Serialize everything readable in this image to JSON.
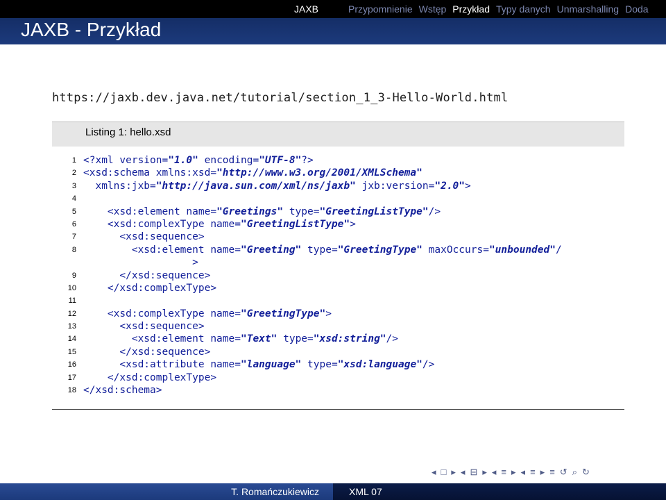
{
  "header": {
    "section": "JAXB",
    "subsections": [
      "Przypomnienie",
      "Wstęp",
      "Przykład",
      "Typy danych",
      "Unmarshalling",
      "Doda"
    ],
    "active_subsection": 2,
    "title": "JAXB - Przykład"
  },
  "url": "https://jaxb.dev.java.net/tutorial/section_1_3-Hello-World.html",
  "listing": {
    "caption": "Listing 1: hello.xsd",
    "lines": [
      {
        "n": "1",
        "segs": [
          [
            "t",
            "<?xml version="
          ],
          [
            "s",
            "\"1.0\""
          ],
          [
            "t",
            " encoding="
          ],
          [
            "s",
            "\"UTF-8\""
          ],
          [
            "t",
            "?>"
          ]
        ]
      },
      {
        "n": "2",
        "segs": [
          [
            "t",
            "<xsd:schema xmlns:xsd="
          ],
          [
            "s",
            "\"http://www.w3.org/2001/XMLSchema\""
          ]
        ]
      },
      {
        "n": "3",
        "segs": [
          [
            "t",
            "  xmlns:jxb="
          ],
          [
            "s",
            "\"http://java.sun.com/xml/ns/jaxb\""
          ],
          [
            "t",
            " jxb:version="
          ],
          [
            "s",
            "\"2.0\""
          ],
          [
            "t",
            ">"
          ]
        ]
      },
      {
        "n": "4",
        "segs": []
      },
      {
        "n": "5",
        "segs": [
          [
            "t",
            "    <xsd:element name="
          ],
          [
            "s",
            "\"Greetings\""
          ],
          [
            "t",
            " type="
          ],
          [
            "s",
            "\"GreetingListType\""
          ],
          [
            "t",
            "/>"
          ]
        ]
      },
      {
        "n": "6",
        "segs": [
          [
            "t",
            "    <xsd:complexType name="
          ],
          [
            "s",
            "\"GreetingListType\""
          ],
          [
            "t",
            ">"
          ]
        ]
      },
      {
        "n": "7",
        "segs": [
          [
            "t",
            "      <xsd:sequence>"
          ]
        ]
      },
      {
        "n": "8",
        "segs": [
          [
            "t",
            "        <xsd:element name="
          ],
          [
            "s",
            "\"Greeting\""
          ],
          [
            "t",
            " type="
          ],
          [
            "s",
            "\"GreetingType\""
          ],
          [
            "t",
            " maxOccurs="
          ],
          [
            "s",
            "\"unbounded\""
          ],
          [
            "t",
            "/"
          ]
        ]
      },
      {
        "n": "",
        "segs": [
          [
            "t",
            "                  >"
          ]
        ]
      },
      {
        "n": "9",
        "segs": [
          [
            "t",
            "      </xsd:sequence>"
          ]
        ]
      },
      {
        "n": "10",
        "segs": [
          [
            "t",
            "    </xsd:complexType>"
          ]
        ]
      },
      {
        "n": "11",
        "segs": []
      },
      {
        "n": "12",
        "segs": [
          [
            "t",
            "    <xsd:complexType name="
          ],
          [
            "s",
            "\"GreetingType\""
          ],
          [
            "t",
            ">"
          ]
        ]
      },
      {
        "n": "13",
        "segs": [
          [
            "t",
            "      <xsd:sequence>"
          ]
        ]
      },
      {
        "n": "14",
        "segs": [
          [
            "t",
            "        <xsd:element name="
          ],
          [
            "s",
            "\"Text\""
          ],
          [
            "t",
            " type="
          ],
          [
            "s",
            "\"xsd:string\""
          ],
          [
            "t",
            "/>"
          ]
        ]
      },
      {
        "n": "15",
        "segs": [
          [
            "t",
            "      </xsd:sequence>"
          ]
        ]
      },
      {
        "n": "16",
        "segs": [
          [
            "t",
            "      <xsd:attribute name="
          ],
          [
            "s",
            "\"language\""
          ],
          [
            "t",
            " type="
          ],
          [
            "s",
            "\"xsd:language\""
          ],
          [
            "t",
            "/>"
          ]
        ]
      },
      {
        "n": "17",
        "segs": [
          [
            "t",
            "    </xsd:complexType>"
          ]
        ]
      },
      {
        "n": "18",
        "segs": [
          [
            "t",
            "</xsd:schema>"
          ]
        ]
      }
    ]
  },
  "nav_symbols": [
    "◂",
    "□",
    "▸",
    "◂",
    "⊟",
    "▸",
    "◂",
    "≡",
    "▸",
    "◂",
    "≡",
    "▸",
    "≡",
    "↺",
    "⌕",
    "↻"
  ],
  "footer": {
    "author": "T. Romańczukiewicz",
    "course": "XML 07"
  },
  "colors": {
    "header_bg": "#16306a",
    "topnav_bg": "#000000",
    "code_keyword": "#13209a",
    "caption_bg": "#e6e6e6"
  }
}
